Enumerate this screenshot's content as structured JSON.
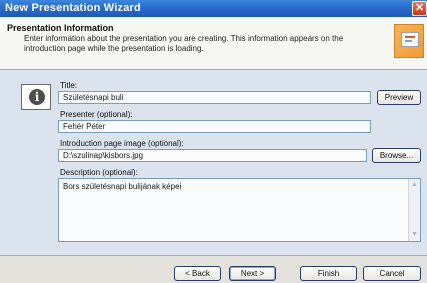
{
  "window": {
    "title": "New Presentation Wizard",
    "close_glyph": "✕"
  },
  "header": {
    "title": "Presentation Information",
    "description": "Enter information about the presentation you are creating. This information appears on the introduction page while the presentation is loading.",
    "image_icon": "wizard-graphic-icon"
  },
  "form": {
    "info_icon": "info-icon",
    "title_label": "Title:",
    "title_value": "Születésnapi buli",
    "preview_label": "Preview",
    "presenter_label": "Presenter (optional):",
    "presenter_value": "Fehér Péter",
    "image_label": "Introduction page image (optional):",
    "image_value": "D:\\szulinap\\kisbors.jpg",
    "browse_label": "Browse...",
    "description_label": "Description (optional):",
    "description_value": "Bors születésnapi bulijának képei"
  },
  "footer": {
    "back_label": "< Back",
    "next_label": "Next >",
    "finish_label": "Finish",
    "cancel_label": "Cancel"
  },
  "colors": {
    "titlebar": "#2a6bcc",
    "close_button": "#c7381c",
    "body_background": "#dbe4ee",
    "textbox_border": "#7b9ebd"
  }
}
